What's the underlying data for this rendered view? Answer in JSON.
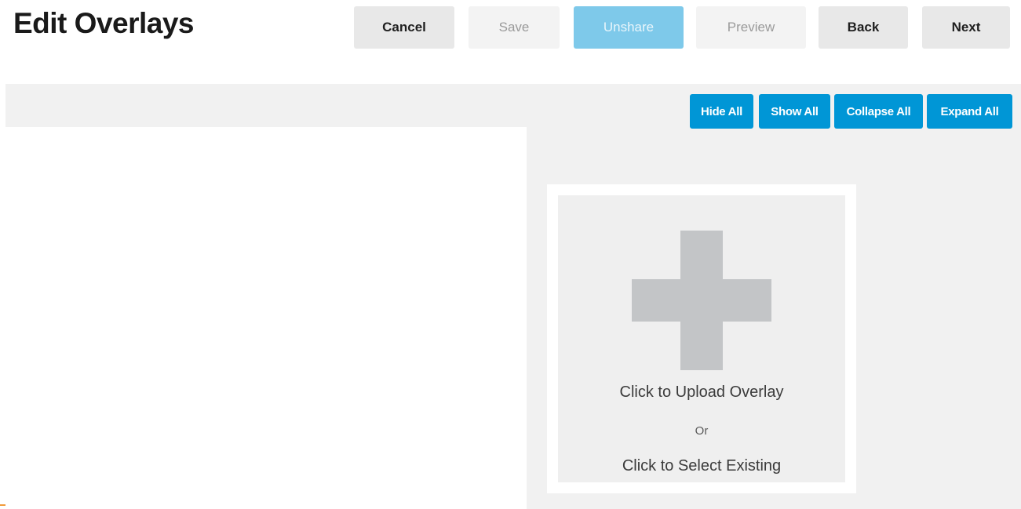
{
  "page": {
    "title": "Edit Overlays"
  },
  "header_buttons": {
    "cancel": "Cancel",
    "save": "Save",
    "unshare": "Unshare",
    "preview": "Preview",
    "back": "Back",
    "next": "Next"
  },
  "toolbar": {
    "hide_all": "Hide All",
    "show_all": "Show All",
    "collapse_all": "Collapse All",
    "expand_all": "Expand All"
  },
  "upload": {
    "icon": "plus-icon",
    "upload_label": "Click to Upload Overlay",
    "or_label": "Or",
    "select_label": "Click to Select Existing"
  },
  "colors": {
    "primary_blue": "#0096d6",
    "unshare_blue_disabled": "#7ec9ea",
    "panel_gray": "#f1f1f1",
    "plus_gray": "#c3c5c7"
  }
}
